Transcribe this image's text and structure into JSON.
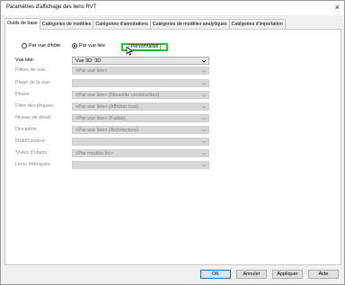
{
  "window": {
    "title": "Paramètres d'affichage des liens RVT",
    "close_glyph": "×"
  },
  "tabs": [
    {
      "label": "Outils de base",
      "active": true
    },
    {
      "label": "Catégories de modèles",
      "active": false
    },
    {
      "label": "Catégories d'annotations",
      "active": false
    },
    {
      "label": "Catégories de modèles analytiques",
      "active": false
    },
    {
      "label": "Catégories d'importation",
      "active": false
    }
  ],
  "display_mode": {
    "options": [
      {
        "label": "Par vue d'hôte",
        "selected": false
      },
      {
        "label": "Par vue liée",
        "selected": true
      }
    ],
    "custom_label": "Personnalisé",
    "highlight_color": "#16d02a"
  },
  "fields": [
    {
      "label": "Vue liée:",
      "value": "Vue 3D: 3D",
      "enabled": true
    },
    {
      "label": "Filtres de vue:",
      "value": "<Par vue liée>",
      "enabled": false
    },
    {
      "label": "Plage de la vue:",
      "value": "",
      "enabled": false
    },
    {
      "label": "Phase:",
      "value": "<Par vue liée> (Nouvelle construction)",
      "enabled": false
    },
    {
      "label": "Filtre des phases:",
      "value": "<Par vue liée> (Afficher tout)",
      "enabled": false
    },
    {
      "label": "Niveau de détail:",
      "value": "<Par vue liée> (Faible)",
      "enabled": false
    },
    {
      "label": "Discipline:",
      "value": "<Par vue liée> (Architecture)",
      "enabled": false
    },
    {
      "label": "Motif/Couleur:",
      "value": "",
      "enabled": false
    },
    {
      "label": "Styles d'objets:",
      "value": "<Par modèle lié>",
      "enabled": false
    },
    {
      "label": "Liens imbriqués:",
      "value": "",
      "enabled": false
    }
  ],
  "footer": {
    "ok": "OK",
    "cancel": "Annuler",
    "apply": "Appliquer",
    "help": "Aide"
  }
}
